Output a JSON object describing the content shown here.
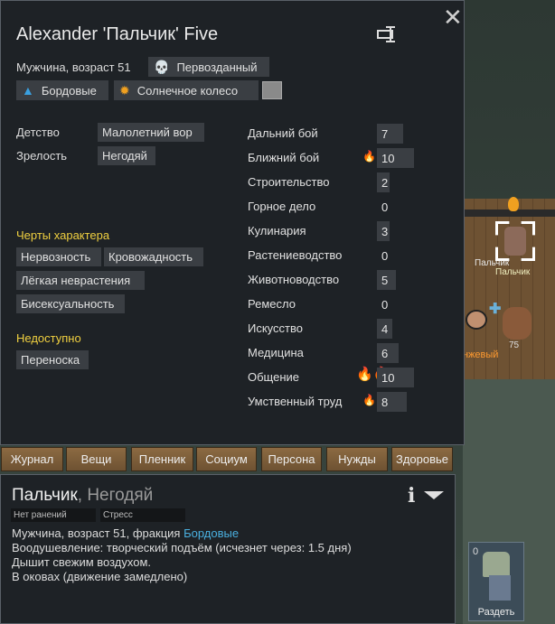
{
  "character": {
    "name": "Alexander 'Пальчик' Five",
    "description": "Мужчина, возраст 51",
    "ideo_symbol": "Первозданный",
    "faction": "Бордовые",
    "ideology": "Солнечное колесо"
  },
  "backstory": {
    "childhood_label": "Детство",
    "childhood_value": "Малолетний вор",
    "adulthood_label": "Зрелость",
    "adulthood_value": "Негодяй"
  },
  "traits": {
    "heading": "Черты характера",
    "items": [
      "Нервозность",
      "Кровожадность",
      "Лёгкая неврастения",
      "Бисексуальность"
    ]
  },
  "disabled": {
    "heading": "Недоступно",
    "items": [
      "Переноска"
    ]
  },
  "skills": [
    {
      "label": "Дальний бой",
      "value": "7",
      "passion": 0
    },
    {
      "label": "Ближний бой",
      "value": "10",
      "passion": 1
    },
    {
      "label": "Строительство",
      "value": "2",
      "passion": 0
    },
    {
      "label": "Горное дело",
      "value": "0",
      "passion": 0
    },
    {
      "label": "Кулинария",
      "value": "3",
      "passion": 0
    },
    {
      "label": "Растениеводство",
      "value": "0",
      "passion": 0
    },
    {
      "label": "Животноводство",
      "value": "5",
      "passion": 0
    },
    {
      "label": "Ремесло",
      "value": "0",
      "passion": 0
    },
    {
      "label": "Искусство",
      "value": "4",
      "passion": 0
    },
    {
      "label": "Медицина",
      "value": "6",
      "passion": 0
    },
    {
      "label": "Общение",
      "value": "10",
      "passion": 2
    },
    {
      "label": "Умственный труд",
      "value": "8",
      "passion": 1
    }
  ],
  "tabs": [
    "Журнал",
    "Вещи",
    "Пленник",
    "Социум",
    "Персона",
    "Нужды",
    "Здоровье"
  ],
  "inspect": {
    "name": "Пальчик",
    "subtitle": ", Негодяй",
    "bar1": "Нет ранений",
    "bar2": "Стресс",
    "line1_prefix": "Мужчина, возраст 51, фракция ",
    "line1_faction": "Бордовые",
    "line2": "Воодушевление: творческий подъём (исчезнет через: 1.5 дня)",
    "line3": "Дышит свежим воздухом.",
    "line4": "В оковах (движение замедлено)"
  },
  "map": {
    "pawn_label_1": "Пальчик",
    "pawn_label_2": "Пальчик",
    "item_count": "75",
    "orange_label": "нжевый"
  },
  "strip": {
    "count": "0",
    "label": "Раздеть"
  },
  "colors": {
    "passion": "#f0a020",
    "faction": "#4ab0e0",
    "section_heading": "#f0d040"
  }
}
